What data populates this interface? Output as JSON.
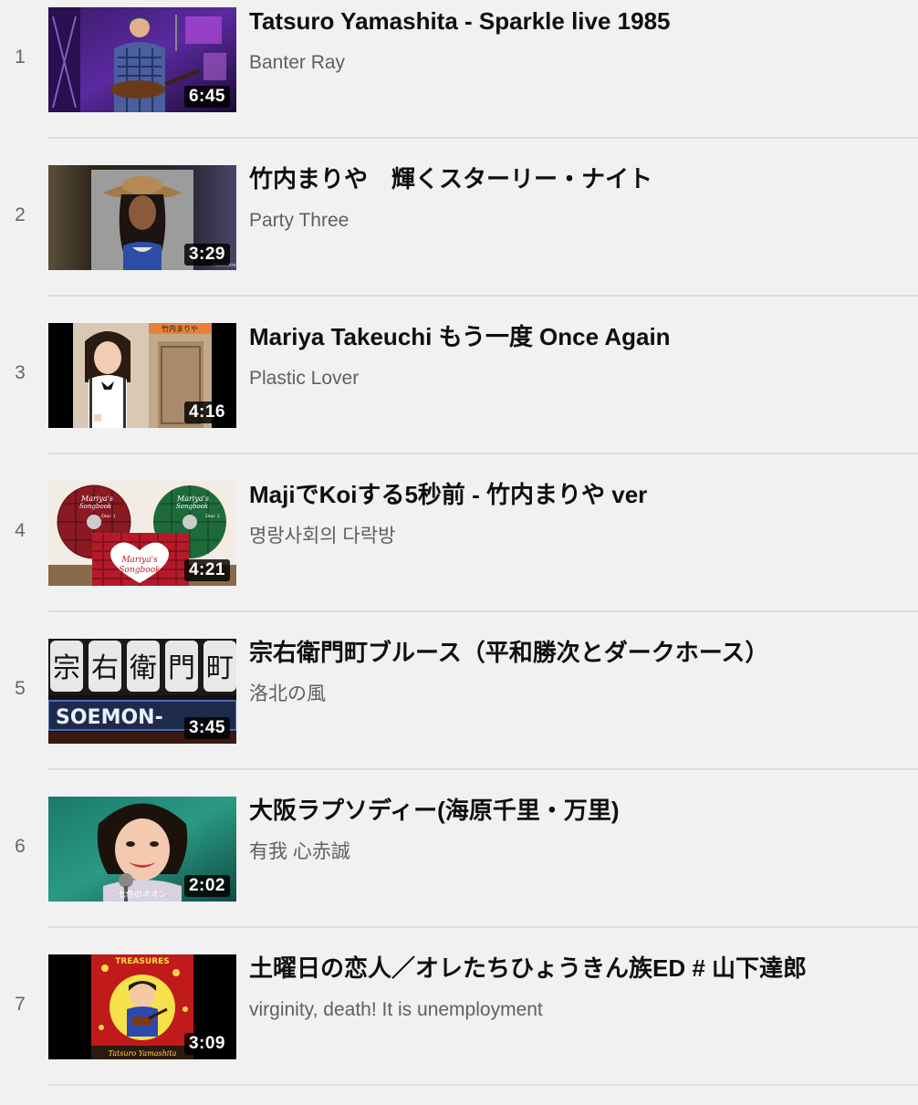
{
  "playlist": {
    "items": [
      {
        "index": "1",
        "title": "Tatsuro Yamashita - Sparkle live 1985",
        "channel": "Banter Ray",
        "duration": "6:45"
      },
      {
        "index": "2",
        "title": "竹内まりや　輝くスターリー・ナイト",
        "channel": "Party Three",
        "duration": "3:29"
      },
      {
        "index": "3",
        "title": "Mariya Takeuchi もう一度 Once Again",
        "channel": "Plastic Lover",
        "duration": "4:16"
      },
      {
        "index": "4",
        "title": "MajiでKoiする5秒前 - 竹内まりや ver",
        "channel": "명랑사회의 다락방",
        "duration": "4:21"
      },
      {
        "index": "5",
        "title": "宗右衛門町ブルース（平和勝次とダークホース）",
        "channel": "洛北の風",
        "duration": "3:45"
      },
      {
        "index": "6",
        "title": "大阪ラプソディー(海原千里・万里)",
        "channel": "有我 心赤誠",
        "duration": "2:02"
      },
      {
        "index": "7",
        "title": "土曜日の恋人／オレたちひょうきん族ED # 山下達郎",
        "channel": "virginity, death! It is unemployment",
        "duration": "3:09"
      }
    ]
  },
  "thumbnails": {
    "t4_left_disc": "Mariya's Songbook",
    "t4_right_disc": "Mariya's Songbook",
    "t4_disc1": "Disc 1",
    "t4_disc2": "Disc 2",
    "t4_heart_line1": "Mariya's",
    "t4_heart_line2": "Songbook",
    "t3_banner": "竹内まりや",
    "t5_sign": "SOEMON-",
    "t7_banner": "TREASURES",
    "t7_footer": "Tatsuro Yamashita"
  },
  "colors": {
    "background": "#f1f1f1",
    "title": "#0f0f0f",
    "channel": "#606060",
    "index": "#666666"
  }
}
